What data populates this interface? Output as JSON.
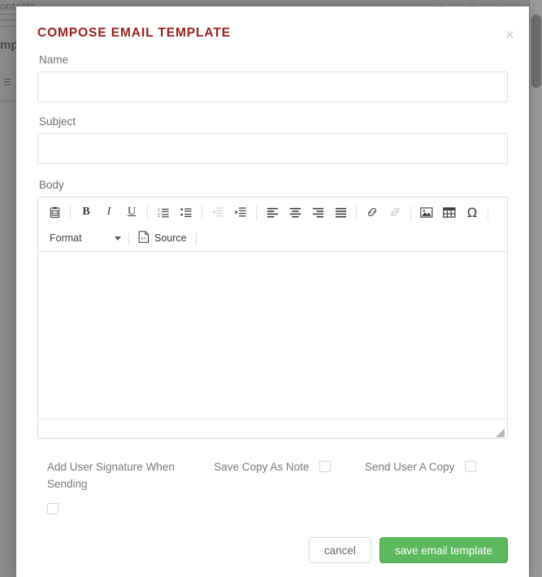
{
  "background": {
    "topbar_text": "ontacts...",
    "left_label": "mp",
    "left_icon": "list-icon",
    "top_icons": [
      "plus-icon",
      "link-icon",
      "trash-icon",
      "history-icon"
    ]
  },
  "modal": {
    "title": "COMPOSE EMAIL TEMPLATE",
    "close_label": "×",
    "fields": {
      "name": {
        "label": "Name",
        "value": "",
        "placeholder": ""
      },
      "subject": {
        "label": "Subject",
        "value": "",
        "placeholder": ""
      },
      "body": {
        "label": "Body",
        "value": ""
      }
    },
    "editor": {
      "toolbar_row1": [
        {
          "name": "paste-from-word-icon",
          "title": "Paste from Word",
          "disabled": false
        },
        {
          "name": "separator",
          "title": "",
          "disabled": false
        },
        {
          "name": "bold-icon",
          "title": "Bold",
          "disabled": false
        },
        {
          "name": "italic-icon",
          "title": "Italic",
          "disabled": false
        },
        {
          "name": "underline-icon",
          "title": "Underline",
          "disabled": false
        },
        {
          "name": "separator",
          "title": "",
          "disabled": false
        },
        {
          "name": "numbered-list-icon",
          "title": "Insert/Remove Numbered List",
          "disabled": false
        },
        {
          "name": "bulleted-list-icon",
          "title": "Insert/Remove Bulleted List",
          "disabled": false
        },
        {
          "name": "separator",
          "title": "",
          "disabled": false
        },
        {
          "name": "outdent-icon",
          "title": "Decrease Indent",
          "disabled": true
        },
        {
          "name": "indent-icon",
          "title": "Increase Indent",
          "disabled": false
        },
        {
          "name": "separator",
          "title": "",
          "disabled": false
        },
        {
          "name": "align-left-icon",
          "title": "Align Left",
          "disabled": false
        },
        {
          "name": "align-center-icon",
          "title": "Center",
          "disabled": false
        },
        {
          "name": "align-right-icon",
          "title": "Align Right",
          "disabled": false
        },
        {
          "name": "justify-icon",
          "title": "Justify",
          "disabled": false
        },
        {
          "name": "separator",
          "title": "",
          "disabled": false
        },
        {
          "name": "link-icon",
          "title": "Link",
          "disabled": false
        },
        {
          "name": "unlink-icon",
          "title": "Unlink",
          "disabled": true
        },
        {
          "name": "separator",
          "title": "",
          "disabled": false
        },
        {
          "name": "image-icon",
          "title": "Image",
          "disabled": false
        },
        {
          "name": "table-icon",
          "title": "Table",
          "disabled": false
        },
        {
          "name": "special-char-icon",
          "title": "Insert Special Character",
          "disabled": false
        },
        {
          "name": "separator",
          "title": "",
          "disabled": false
        }
      ],
      "format_select": {
        "label": "Format",
        "icon": "chevron-down-icon"
      },
      "source_button": {
        "label": "Source",
        "icon": "source-code-icon"
      }
    },
    "checkboxes": [
      {
        "label": "Add User Signature When Sending",
        "checked": false
      },
      {
        "label": "Save Copy As Note",
        "checked": false
      },
      {
        "label": "Send User A Copy",
        "checked": false
      }
    ],
    "buttons": {
      "cancel": "cancel",
      "save": "save email template"
    }
  },
  "colors": {
    "title": "#9c2220",
    "save_button": "#5cb85c",
    "label_text": "#6f6f6f",
    "border": "#dfdfdf"
  }
}
